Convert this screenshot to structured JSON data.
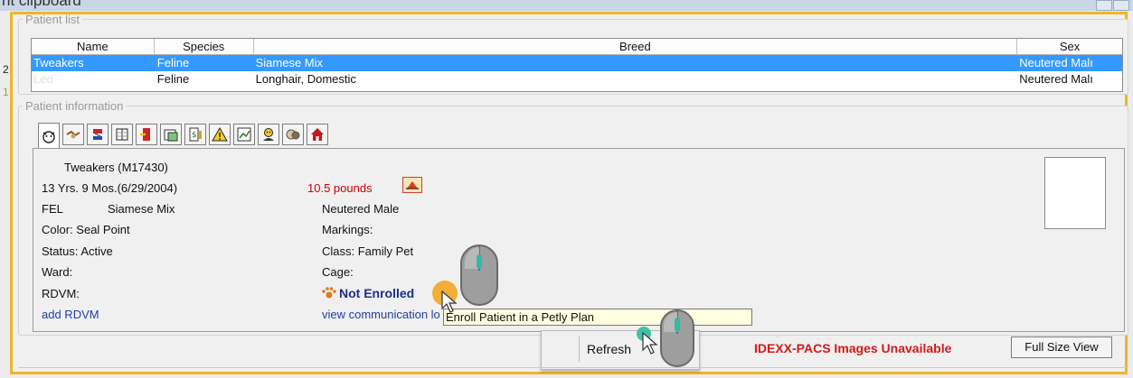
{
  "window": {
    "title_fragment": "nt clipboard"
  },
  "patient_list": {
    "legend": "Patient list",
    "columns": [
      "Name",
      "Species",
      "Breed",
      "Sex"
    ],
    "rows": [
      {
        "name": "Tweakers",
        "species": "Feline",
        "breed": "Siamese Mix",
        "sex": "Neutered Malı",
        "selected": true
      },
      {
        "name": "Leo",
        "species": "Feline",
        "breed": "Longhair, Domestic",
        "sex": "Neutered Malı",
        "selected": false
      }
    ]
  },
  "patient_info": {
    "legend": "Patient information",
    "tab_icons": [
      "paw-head-icon",
      "handshake-icon",
      "syringe-icon",
      "ledger-icon",
      "door-exit-icon",
      "calendar-icon",
      "invoice-icon",
      "warning-icon",
      "chart-icon",
      "person-icon",
      "pets-icon",
      "home-icon"
    ],
    "name_line": "Tweakers  (M17430)",
    "age_line": "13 Yrs. 9 Mos.(6/29/2004)",
    "weight": "10.5  pounds",
    "species_code": "FEL",
    "breed": "Siamese Mix",
    "sex": "Neutered Male",
    "color": "Color:  Seal Point",
    "markings": "Markings:",
    "status": "Status:  Active",
    "class": "Class:  Family Pet",
    "ward": "Ward:",
    "cage": "Cage:",
    "rdvm": "RDVM:",
    "enroll_status": "Not Enrolled",
    "add_rdvm": "add RDVM",
    "view_comm": "view communication lo",
    "tooltip": "Enroll Patient in a Petly Plan"
  },
  "bottom": {
    "refresh": "Refresh",
    "pacs": "IDEXX-PACS Images Unavailable",
    "full_size": "Full Size View"
  },
  "left_marks": [
    "2",
    "1"
  ],
  "colors": {
    "selection": "#3399ff",
    "highlight_frame": "#f0b429",
    "alert_red": "#d21919",
    "link_blue": "#1f3fa5"
  }
}
